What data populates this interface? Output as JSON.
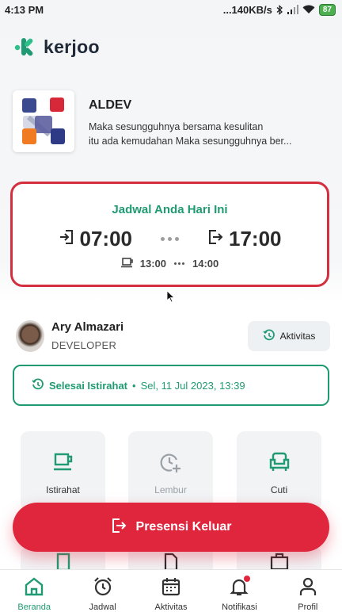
{
  "status_bar": {
    "time": "4:13 PM",
    "net_speed": "...140KB/s",
    "battery": "87"
  },
  "app": {
    "logo_text": "kerjoo"
  },
  "company": {
    "name": "ALDEV",
    "tagline_line1": "Maka sesungguhnya bersama kesulitan",
    "tagline_line2": "itu ada kemudahan Maka sesungguhnya ber..."
  },
  "schedule": {
    "title": "Jadwal Anda Hari Ini",
    "start_time": "07:00",
    "end_time": "17:00",
    "break_start": "13:00",
    "break_end": "14:00"
  },
  "user": {
    "name": "Ary Almazari",
    "role": "DEVELOPER",
    "activity_button": "Aktivitas"
  },
  "break_status": {
    "label": "Selesai Istirahat",
    "separator": "•",
    "datetime": "Sel, 11 Jul 2023, 13:39"
  },
  "tiles": [
    {
      "label": "Istirahat",
      "icon": "coffee-cup-icon",
      "enabled": true
    },
    {
      "label": "Lembur",
      "icon": "clock-plus-icon",
      "enabled": false
    },
    {
      "label": "Cuti",
      "icon": "armchair-icon",
      "enabled": true
    }
  ],
  "checkout_button": {
    "label": "Presensi Keluar"
  },
  "bottom_nav": [
    {
      "label": "Beranda",
      "icon": "home-icon",
      "active": true
    },
    {
      "label": "Jadwal",
      "icon": "alarm-clock-icon",
      "active": false
    },
    {
      "label": "Aktivitas",
      "icon": "calendar-icon",
      "active": false
    },
    {
      "label": "Notifikasi",
      "icon": "bell-icon",
      "active": false
    },
    {
      "label": "Profil",
      "icon": "person-icon",
      "active": false
    }
  ],
  "colors": {
    "brand_green": "#1f9a72",
    "accent_red": "#e0263d",
    "highlight_border": "#d32f3f"
  }
}
